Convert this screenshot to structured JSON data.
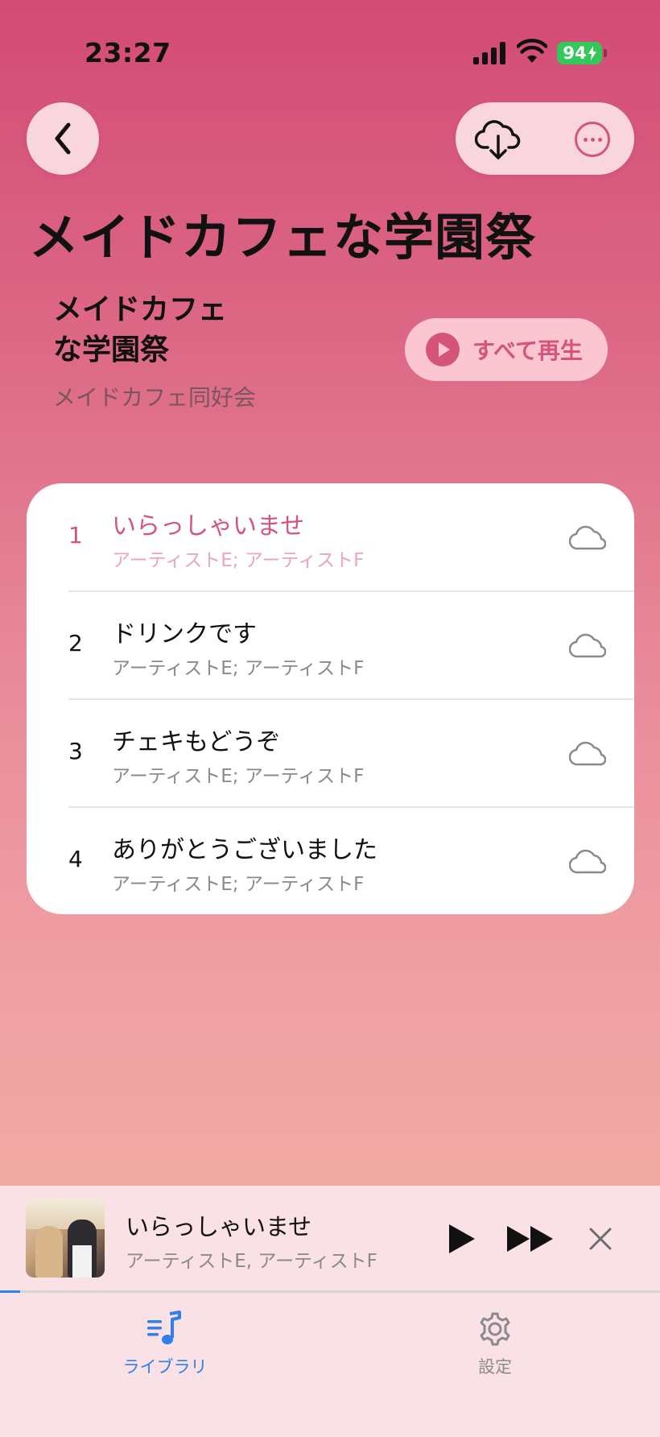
{
  "status_bar": {
    "time": "23:27",
    "battery": "94"
  },
  "header": {
    "title": "メイドカフェな学園祭",
    "back_icon": "chevron-left-icon",
    "download_icon": "cloud-download-icon",
    "more_icon": "ellipsis-circle-icon"
  },
  "album": {
    "title_line1": "メイドカフェ",
    "title_line2": "な学園祭",
    "artist": "メイドカフェ同好会",
    "play_all_label": "すべて再生"
  },
  "tracks": [
    {
      "number": "1",
      "title": "いらっしゃいませ",
      "artist": "アーティストE; アーティストF",
      "active": true
    },
    {
      "number": "2",
      "title": "ドリンクです",
      "artist": "アーティストE; アーティストF",
      "active": false
    },
    {
      "number": "3",
      "title": "チェキもどうぞ",
      "artist": "アーティストE; アーティストF",
      "active": false
    },
    {
      "number": "4",
      "title": "ありがとうございました",
      "artist": "アーティストE; アーティストF",
      "active": false
    }
  ],
  "now_playing": {
    "title": "いらっしゃいませ",
    "artist": "アーティストE, アーティストF",
    "progress": 0.03
  },
  "tabs": [
    {
      "label": "ライブラリ",
      "icon": "music-library-icon",
      "selected": true
    },
    {
      "label": "設定",
      "icon": "gear-icon",
      "selected": false
    }
  ],
  "colors": {
    "accent": "#d4547a",
    "tab_active": "#2f80ed",
    "battery": "#34c759"
  }
}
